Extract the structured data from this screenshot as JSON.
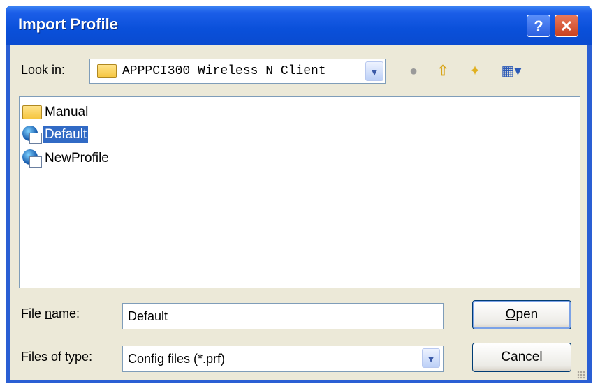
{
  "window": {
    "title": "Import Profile",
    "help_label": "?",
    "close_label": "✕"
  },
  "lookin": {
    "label_pre": "Look ",
    "label_access": "i",
    "label_post": "n:",
    "value": "APPPCI300 Wireless N Client",
    "dropdown_icon": "chevron-down-icon"
  },
  "toolbar": {
    "back_icon": "●",
    "up_icon": "⇧",
    "new_folder_icon": "✦",
    "views_icon": "▦▾"
  },
  "files": [
    {
      "name": "Manual",
      "type": "folder",
      "selected": false
    },
    {
      "name": "Default",
      "type": "profile",
      "selected": true
    },
    {
      "name": "NewProfile",
      "type": "profile",
      "selected": false
    }
  ],
  "filename": {
    "label_pre": "File ",
    "label_access": "n",
    "label_post": "ame:",
    "value": "Default"
  },
  "filetype": {
    "label_pre": "Files of ",
    "label_access": "t",
    "label_post": "ype:",
    "value": "Config files (*.prf)"
  },
  "buttons": {
    "open_access": "O",
    "open_rest": "pen",
    "cancel": "Cancel"
  },
  "colors": {
    "titlebar": "#0a50da",
    "selection": "#316ac5",
    "dialog_bg": "#ece9d8"
  }
}
